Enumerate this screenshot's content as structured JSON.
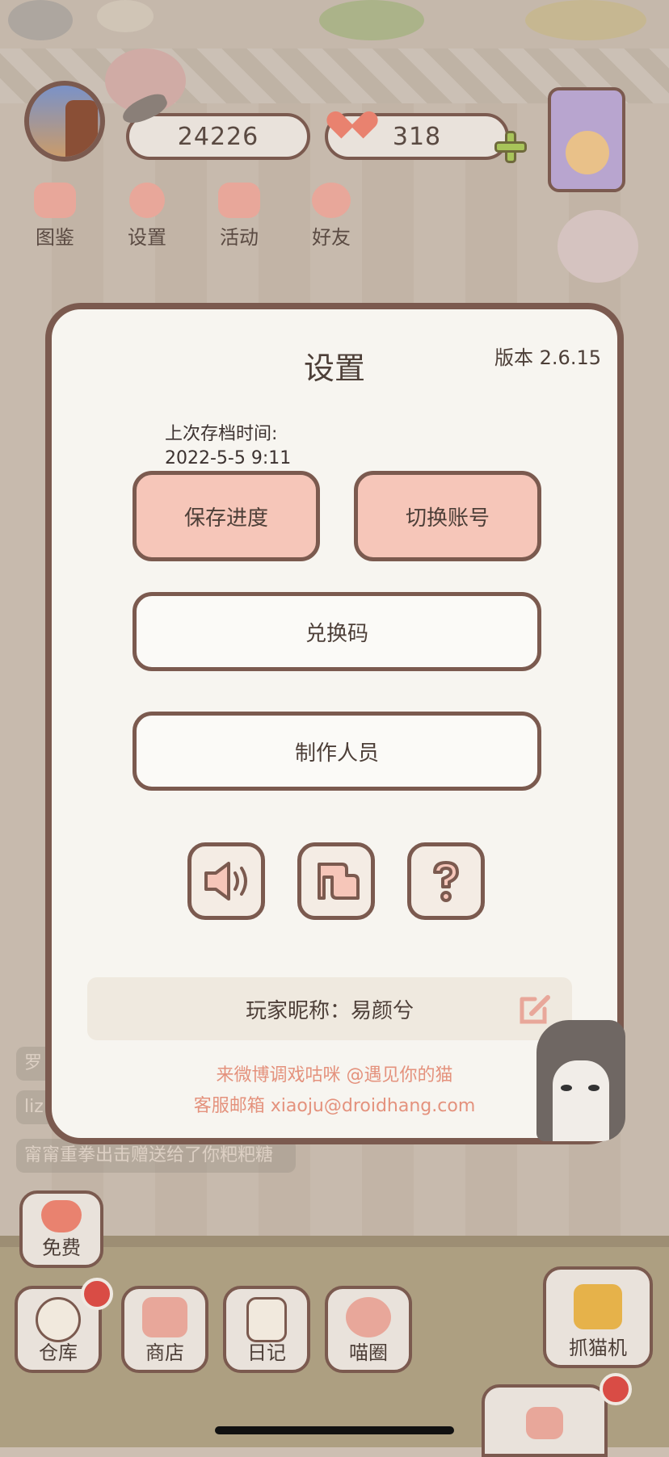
{
  "hud": {
    "fish_count": "24226",
    "heart_count": "318",
    "top_buttons": [
      {
        "label": "图鉴"
      },
      {
        "label": "设置"
      },
      {
        "label": "活动"
      },
      {
        "label": "好友"
      }
    ]
  },
  "chat": {
    "messages": [
      {
        "text": "罗"
      },
      {
        "text": "liz"
      },
      {
        "text": "甯甯重拳出击赠送给了你粑粑糖"
      }
    ]
  },
  "settings": {
    "title": "设置",
    "version": "版本 2.6.15",
    "last_save_label": "上次存档时间:",
    "last_save_time": "2022-5-5 9:11",
    "save_button": "保存进度",
    "switch_account_button": "切换账号",
    "redeem_code_button": "兑换码",
    "credits_button": "制作人员",
    "icons": [
      "sound-icon",
      "music-icon",
      "help-icon"
    ],
    "nickname": "玩家昵称：易颜兮",
    "weibo_text": "来微博调戏咕咪 @遇见你的猫",
    "email_text": "客服邮箱 xiaoju@droidhang.com"
  },
  "bottom_bar": {
    "free": "免费",
    "warehouse": "仓库",
    "shop": "商店",
    "diary": "日记",
    "circle": "喵圈",
    "claw_machine": "抓猫机"
  },
  "colors": {
    "outline": "#7b5a4f",
    "pink_button": "#f6c6b9",
    "accent_text": "#e4927d",
    "notification": "#d94c45"
  }
}
